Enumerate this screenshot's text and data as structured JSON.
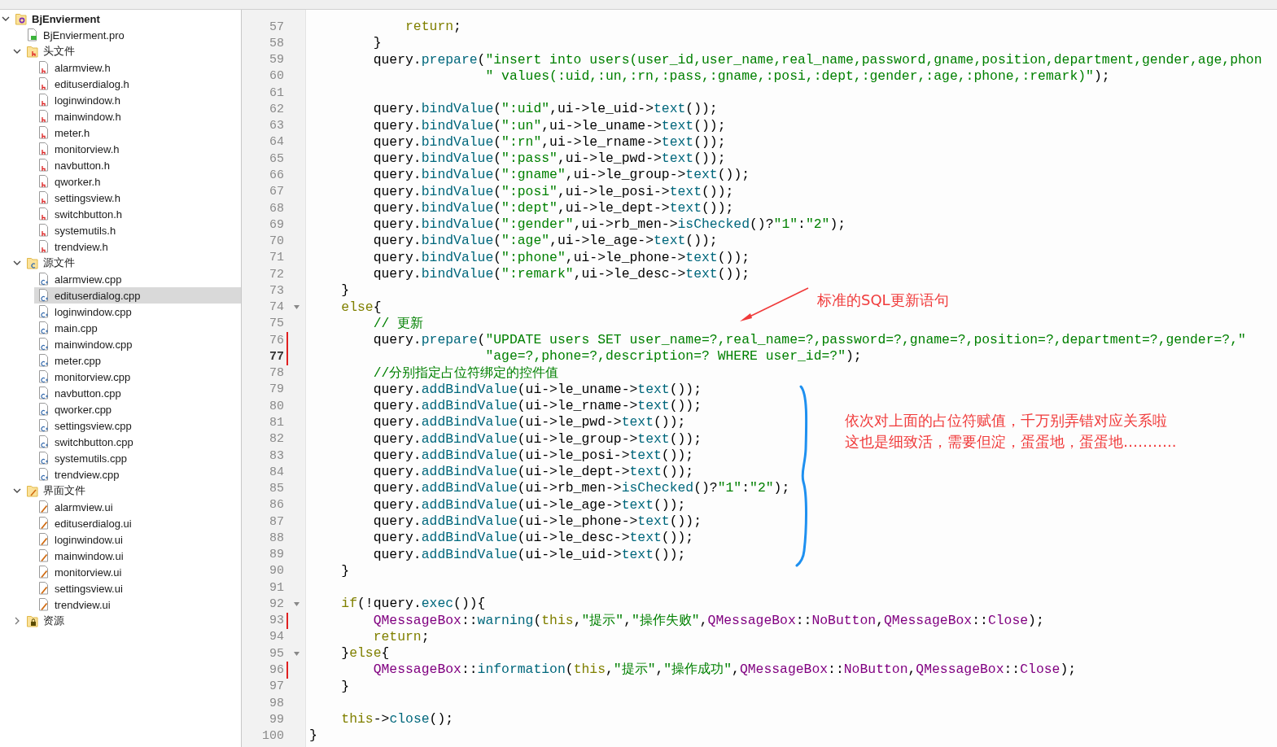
{
  "project_tree": [
    {
      "label": "BjEnvierment",
      "kind": "project",
      "expanded": true,
      "selected": false,
      "children": [
        {
          "label": "BjEnvierment.pro",
          "kind": "pro-file",
          "selected": false
        },
        {
          "label": "头文件",
          "kind": "header-folder",
          "expanded": true,
          "selected": false,
          "children": [
            {
              "label": "alarmview.h",
              "kind": "header",
              "selected": false
            },
            {
              "label": "edituserdialog.h",
              "kind": "header",
              "selected": false
            },
            {
              "label": "loginwindow.h",
              "kind": "header",
              "selected": false
            },
            {
              "label": "mainwindow.h",
              "kind": "header",
              "selected": false
            },
            {
              "label": "meter.h",
              "kind": "header",
              "selected": false
            },
            {
              "label": "monitorview.h",
              "kind": "header",
              "selected": false
            },
            {
              "label": "navbutton.h",
              "kind": "header",
              "selected": false
            },
            {
              "label": "qworker.h",
              "kind": "header",
              "selected": false
            },
            {
              "label": "settingsview.h",
              "kind": "header",
              "selected": false
            },
            {
              "label": "switchbutton.h",
              "kind": "header",
              "selected": false
            },
            {
              "label": "systemutils.h",
              "kind": "header",
              "selected": false
            },
            {
              "label": "trendview.h",
              "kind": "header",
              "selected": false
            }
          ]
        },
        {
          "label": "源文件",
          "kind": "source-folder",
          "expanded": true,
          "selected": false,
          "children": [
            {
              "label": "alarmview.cpp",
              "kind": "source",
              "selected": false
            },
            {
              "label": "edituserdialog.cpp",
              "kind": "source",
              "selected": true
            },
            {
              "label": "loginwindow.cpp",
              "kind": "source",
              "selected": false
            },
            {
              "label": "main.cpp",
              "kind": "source",
              "selected": false
            },
            {
              "label": "mainwindow.cpp",
              "kind": "source",
              "selected": false
            },
            {
              "label": "meter.cpp",
              "kind": "source",
              "selected": false
            },
            {
              "label": "monitorview.cpp",
              "kind": "source",
              "selected": false
            },
            {
              "label": "navbutton.cpp",
              "kind": "source",
              "selected": false
            },
            {
              "label": "qworker.cpp",
              "kind": "source",
              "selected": false
            },
            {
              "label": "settingsview.cpp",
              "kind": "source",
              "selected": false
            },
            {
              "label": "switchbutton.cpp",
              "kind": "source",
              "selected": false
            },
            {
              "label": "systemutils.cpp",
              "kind": "source",
              "selected": false
            },
            {
              "label": "trendview.cpp",
              "kind": "source",
              "selected": false
            }
          ]
        },
        {
          "label": "界面文件",
          "kind": "forms-folder",
          "expanded": true,
          "selected": false,
          "children": [
            {
              "label": "alarmview.ui",
              "kind": "form",
              "selected": false
            },
            {
              "label": "edituserdialog.ui",
              "kind": "form",
              "selected": false
            },
            {
              "label": "loginwindow.ui",
              "kind": "form",
              "selected": false
            },
            {
              "label": "mainwindow.ui",
              "kind": "form",
              "selected": false
            },
            {
              "label": "monitorview.ui",
              "kind": "form",
              "selected": false
            },
            {
              "label": "settingsview.ui",
              "kind": "form",
              "selected": false
            },
            {
              "label": "trendview.ui",
              "kind": "form",
              "selected": false
            }
          ]
        },
        {
          "label": "资源",
          "kind": "resource-folder",
          "expanded": false,
          "selected": false
        }
      ]
    }
  ],
  "editor": {
    "lines": [
      {
        "number": "57",
        "changed": false,
        "foldable": false,
        "current": false,
        "tokens": [
          {
            "kind": "keyword",
            "text": "            return"
          },
          {
            "kind": "plain",
            "text": ";"
          }
        ]
      },
      {
        "number": "58",
        "changed": false,
        "foldable": false,
        "current": false,
        "tokens": [
          {
            "kind": "plain",
            "text": "        }"
          }
        ]
      },
      {
        "number": "59",
        "changed": false,
        "foldable": false,
        "current": false,
        "tokens": [
          {
            "kind": "plain",
            "text": "        query."
          },
          {
            "kind": "function",
            "text": "prepare"
          },
          {
            "kind": "plain",
            "text": "("
          },
          {
            "kind": "string",
            "text": "\"insert into users(user_id,user_name,real_name,password,gname,position,department,gender,age,phon"
          }
        ]
      },
      {
        "number": "60",
        "changed": false,
        "foldable": false,
        "current": false,
        "tokens": [
          {
            "kind": "string",
            "text": "                      \" values(:uid,:un,:rn,:pass,:gname,:posi,:dept,:gender,:age,:phone,:remark)\""
          },
          {
            "kind": "plain",
            "text": ");"
          }
        ]
      },
      {
        "number": "61",
        "changed": false,
        "foldable": false,
        "current": false
      },
      {
        "number": "62",
        "changed": false,
        "foldable": false,
        "current": false,
        "tokens": [
          {
            "kind": "plain",
            "text": "        query."
          },
          {
            "kind": "function",
            "text": "bindValue"
          },
          {
            "kind": "plain",
            "text": "("
          },
          {
            "kind": "string",
            "text": "\":uid\""
          },
          {
            "kind": "plain",
            "text": ",ui->le_uid->"
          },
          {
            "kind": "function",
            "text": "text"
          },
          {
            "kind": "plain",
            "text": "());"
          }
        ]
      },
      {
        "number": "63",
        "changed": false,
        "foldable": false,
        "current": false,
        "tokens": [
          {
            "kind": "plain",
            "text": "        query."
          },
          {
            "kind": "function",
            "text": "bindValue"
          },
          {
            "kind": "plain",
            "text": "("
          },
          {
            "kind": "string",
            "text": "\":un\""
          },
          {
            "kind": "plain",
            "text": ",ui->le_uname->"
          },
          {
            "kind": "function",
            "text": "text"
          },
          {
            "kind": "plain",
            "text": "());"
          }
        ]
      },
      {
        "number": "64",
        "changed": false,
        "foldable": false,
        "current": false,
        "tokens": [
          {
            "kind": "plain",
            "text": "        query."
          },
          {
            "kind": "function",
            "text": "bindValue"
          },
          {
            "kind": "plain",
            "text": "("
          },
          {
            "kind": "string",
            "text": "\":rn\""
          },
          {
            "kind": "plain",
            "text": ",ui->le_rname->"
          },
          {
            "kind": "function",
            "text": "text"
          },
          {
            "kind": "plain",
            "text": "());"
          }
        ]
      },
      {
        "number": "65",
        "changed": false,
        "foldable": false,
        "current": false,
        "tokens": [
          {
            "kind": "plain",
            "text": "        query."
          },
          {
            "kind": "function",
            "text": "bindValue"
          },
          {
            "kind": "plain",
            "text": "("
          },
          {
            "kind": "string",
            "text": "\":pass\""
          },
          {
            "kind": "plain",
            "text": ",ui->le_pwd->"
          },
          {
            "kind": "function",
            "text": "text"
          },
          {
            "kind": "plain",
            "text": "());"
          }
        ]
      },
      {
        "number": "66",
        "changed": false,
        "foldable": false,
        "current": false,
        "tokens": [
          {
            "kind": "plain",
            "text": "        query."
          },
          {
            "kind": "function",
            "text": "bindValue"
          },
          {
            "kind": "plain",
            "text": "("
          },
          {
            "kind": "string",
            "text": "\":gname\""
          },
          {
            "kind": "plain",
            "text": ",ui->le_group->"
          },
          {
            "kind": "function",
            "text": "text"
          },
          {
            "kind": "plain",
            "text": "());"
          }
        ]
      },
      {
        "number": "67",
        "changed": false,
        "foldable": false,
        "current": false,
        "tokens": [
          {
            "kind": "plain",
            "text": "        query."
          },
          {
            "kind": "function",
            "text": "bindValue"
          },
          {
            "kind": "plain",
            "text": "("
          },
          {
            "kind": "string",
            "text": "\":posi\""
          },
          {
            "kind": "plain",
            "text": ",ui->le_posi->"
          },
          {
            "kind": "function",
            "text": "text"
          },
          {
            "kind": "plain",
            "text": "());"
          }
        ]
      },
      {
        "number": "68",
        "changed": false,
        "foldable": false,
        "current": false,
        "tokens": [
          {
            "kind": "plain",
            "text": "        query."
          },
          {
            "kind": "function",
            "text": "bindValue"
          },
          {
            "kind": "plain",
            "text": "("
          },
          {
            "kind": "string",
            "text": "\":dept\""
          },
          {
            "kind": "plain",
            "text": ",ui->le_dept->"
          },
          {
            "kind": "function",
            "text": "text"
          },
          {
            "kind": "plain",
            "text": "());"
          }
        ]
      },
      {
        "number": "69",
        "changed": false,
        "foldable": false,
        "current": false,
        "tokens": [
          {
            "kind": "plain",
            "text": "        query."
          },
          {
            "kind": "function",
            "text": "bindValue"
          },
          {
            "kind": "plain",
            "text": "("
          },
          {
            "kind": "string",
            "text": "\":gender\""
          },
          {
            "kind": "plain",
            "text": ",ui->rb_men->"
          },
          {
            "kind": "function",
            "text": "isChecked"
          },
          {
            "kind": "plain",
            "text": "()?"
          },
          {
            "kind": "string",
            "text": "\"1\""
          },
          {
            "kind": "plain",
            "text": ":"
          },
          {
            "kind": "string",
            "text": "\"2\""
          },
          {
            "kind": "plain",
            "text": ");"
          }
        ]
      },
      {
        "number": "70",
        "changed": false,
        "foldable": false,
        "current": false,
        "tokens": [
          {
            "kind": "plain",
            "text": "        query."
          },
          {
            "kind": "function",
            "text": "bindValue"
          },
          {
            "kind": "plain",
            "text": "("
          },
          {
            "kind": "string",
            "text": "\":age\""
          },
          {
            "kind": "plain",
            "text": ",ui->le_age->"
          },
          {
            "kind": "function",
            "text": "text"
          },
          {
            "kind": "plain",
            "text": "());"
          }
        ]
      },
      {
        "number": "71",
        "changed": false,
        "foldable": false,
        "current": false,
        "tokens": [
          {
            "kind": "plain",
            "text": "        query."
          },
          {
            "kind": "function",
            "text": "bindValue"
          },
          {
            "kind": "plain",
            "text": "("
          },
          {
            "kind": "string",
            "text": "\":phone\""
          },
          {
            "kind": "plain",
            "text": ",ui->le_phone->"
          },
          {
            "kind": "function",
            "text": "text"
          },
          {
            "kind": "plain",
            "text": "());"
          }
        ]
      },
      {
        "number": "72",
        "changed": false,
        "foldable": false,
        "current": false,
        "tokens": [
          {
            "kind": "plain",
            "text": "        query."
          },
          {
            "kind": "function",
            "text": "bindValue"
          },
          {
            "kind": "plain",
            "text": "("
          },
          {
            "kind": "string",
            "text": "\":remark\""
          },
          {
            "kind": "plain",
            "text": ",ui->le_desc->"
          },
          {
            "kind": "function",
            "text": "text"
          },
          {
            "kind": "plain",
            "text": "());"
          }
        ]
      },
      {
        "number": "73",
        "changed": false,
        "foldable": false,
        "current": false,
        "tokens": [
          {
            "kind": "plain",
            "text": "    }"
          }
        ]
      },
      {
        "number": "74",
        "changed": false,
        "foldable": true,
        "current": false,
        "tokens": [
          {
            "kind": "keyword",
            "text": "    else"
          },
          {
            "kind": "plain",
            "text": "{"
          }
        ]
      },
      {
        "number": "75",
        "changed": false,
        "foldable": false,
        "current": false,
        "tokens": [
          {
            "kind": "comment",
            "text": "        // 更新"
          }
        ]
      },
      {
        "number": "76",
        "changed": true,
        "foldable": false,
        "current": false,
        "tokens": [
          {
            "kind": "plain",
            "text": "        query."
          },
          {
            "kind": "function",
            "text": "prepare"
          },
          {
            "kind": "plain",
            "text": "("
          },
          {
            "kind": "string",
            "text": "\"UPDATE users SET user_name=?,real_name=?,password=?,gname=?,position=?,department=?,gender=?,\""
          }
        ]
      },
      {
        "number": "77",
        "changed": true,
        "foldable": false,
        "current": true,
        "tokens": [
          {
            "kind": "string",
            "text": "                      \"age=?,phone=?,description=? WHERE user_id=?\""
          },
          {
            "kind": "plain",
            "text": ");"
          }
        ]
      },
      {
        "number": "78",
        "changed": false,
        "foldable": false,
        "current": false,
        "tokens": [
          {
            "kind": "comment",
            "text": "        //分别指定占位符绑定的控件值"
          }
        ]
      },
      {
        "number": "79",
        "changed": false,
        "foldable": false,
        "current": false,
        "tokens": [
          {
            "kind": "plain",
            "text": "        query."
          },
          {
            "kind": "function",
            "text": "addBindValue"
          },
          {
            "kind": "plain",
            "text": "(ui->le_uname->"
          },
          {
            "kind": "function",
            "text": "text"
          },
          {
            "kind": "plain",
            "text": "());"
          }
        ]
      },
      {
        "number": "80",
        "changed": false,
        "foldable": false,
        "current": false,
        "tokens": [
          {
            "kind": "plain",
            "text": "        query."
          },
          {
            "kind": "function",
            "text": "addBindValue"
          },
          {
            "kind": "plain",
            "text": "(ui->le_rname->"
          },
          {
            "kind": "function",
            "text": "text"
          },
          {
            "kind": "plain",
            "text": "());"
          }
        ]
      },
      {
        "number": "81",
        "changed": false,
        "foldable": false,
        "current": false,
        "tokens": [
          {
            "kind": "plain",
            "text": "        query."
          },
          {
            "kind": "function",
            "text": "addBindValue"
          },
          {
            "kind": "plain",
            "text": "(ui->le_pwd->"
          },
          {
            "kind": "function",
            "text": "text"
          },
          {
            "kind": "plain",
            "text": "());"
          }
        ]
      },
      {
        "number": "82",
        "changed": false,
        "foldable": false,
        "current": false,
        "tokens": [
          {
            "kind": "plain",
            "text": "        query."
          },
          {
            "kind": "function",
            "text": "addBindValue"
          },
          {
            "kind": "plain",
            "text": "(ui->le_group->"
          },
          {
            "kind": "function",
            "text": "text"
          },
          {
            "kind": "plain",
            "text": "());"
          }
        ]
      },
      {
        "number": "83",
        "changed": false,
        "foldable": false,
        "current": false,
        "tokens": [
          {
            "kind": "plain",
            "text": "        query."
          },
          {
            "kind": "function",
            "text": "addBindValue"
          },
          {
            "kind": "plain",
            "text": "(ui->le_posi->"
          },
          {
            "kind": "function",
            "text": "text"
          },
          {
            "kind": "plain",
            "text": "());"
          }
        ]
      },
      {
        "number": "84",
        "changed": false,
        "foldable": false,
        "current": false,
        "tokens": [
          {
            "kind": "plain",
            "text": "        query."
          },
          {
            "kind": "function",
            "text": "addBindValue"
          },
          {
            "kind": "plain",
            "text": "(ui->le_dept->"
          },
          {
            "kind": "function",
            "text": "text"
          },
          {
            "kind": "plain",
            "text": "());"
          }
        ]
      },
      {
        "number": "85",
        "changed": false,
        "foldable": false,
        "current": false,
        "tokens": [
          {
            "kind": "plain",
            "text": "        query."
          },
          {
            "kind": "function",
            "text": "addBindValue"
          },
          {
            "kind": "plain",
            "text": "(ui->rb_men->"
          },
          {
            "kind": "function",
            "text": "isChecked"
          },
          {
            "kind": "plain",
            "text": "()?"
          },
          {
            "kind": "string",
            "text": "\"1\""
          },
          {
            "kind": "plain",
            "text": ":"
          },
          {
            "kind": "string",
            "text": "\"2\""
          },
          {
            "kind": "plain",
            "text": ");"
          }
        ]
      },
      {
        "number": "86",
        "changed": false,
        "foldable": false,
        "current": false,
        "tokens": [
          {
            "kind": "plain",
            "text": "        query."
          },
          {
            "kind": "function",
            "text": "addBindValue"
          },
          {
            "kind": "plain",
            "text": "(ui->le_age->"
          },
          {
            "kind": "function",
            "text": "text"
          },
          {
            "kind": "plain",
            "text": "());"
          }
        ]
      },
      {
        "number": "87",
        "changed": false,
        "foldable": false,
        "current": false,
        "tokens": [
          {
            "kind": "plain",
            "text": "        query."
          },
          {
            "kind": "function",
            "text": "addBindValue"
          },
          {
            "kind": "plain",
            "text": "(ui->le_phone->"
          },
          {
            "kind": "function",
            "text": "text"
          },
          {
            "kind": "plain",
            "text": "());"
          }
        ]
      },
      {
        "number": "88",
        "changed": false,
        "foldable": false,
        "current": false,
        "tokens": [
          {
            "kind": "plain",
            "text": "        query."
          },
          {
            "kind": "function",
            "text": "addBindValue"
          },
          {
            "kind": "plain",
            "text": "(ui->le_desc->"
          },
          {
            "kind": "function",
            "text": "text"
          },
          {
            "kind": "plain",
            "text": "());"
          }
        ]
      },
      {
        "number": "89",
        "changed": false,
        "foldable": false,
        "current": false,
        "tokens": [
          {
            "kind": "plain",
            "text": "        query."
          },
          {
            "kind": "function",
            "text": "addBindValue"
          },
          {
            "kind": "plain",
            "text": "(ui->le_uid->"
          },
          {
            "kind": "function",
            "text": "text"
          },
          {
            "kind": "plain",
            "text": "());"
          }
        ]
      },
      {
        "number": "90",
        "changed": false,
        "foldable": false,
        "current": false,
        "tokens": [
          {
            "kind": "plain",
            "text": "    }"
          }
        ]
      },
      {
        "number": "91",
        "changed": false,
        "foldable": false,
        "current": false
      },
      {
        "number": "92",
        "changed": false,
        "foldable": true,
        "current": false,
        "tokens": [
          {
            "kind": "keyword",
            "text": "    if"
          },
          {
            "kind": "plain",
            "text": "(!query."
          },
          {
            "kind": "function",
            "text": "exec"
          },
          {
            "kind": "plain",
            "text": "()){"
          }
        ]
      },
      {
        "number": "93",
        "changed": true,
        "foldable": false,
        "current": false,
        "tokens": [
          {
            "kind": "type",
            "text": "        QMessageBox"
          },
          {
            "kind": "plain",
            "text": "::"
          },
          {
            "kind": "function",
            "text": "warning"
          },
          {
            "kind": "plain",
            "text": "("
          },
          {
            "kind": "keyword",
            "text": "this"
          },
          {
            "kind": "plain",
            "text": ","
          },
          {
            "kind": "string",
            "text": "\"提示\""
          },
          {
            "kind": "plain",
            "text": ","
          },
          {
            "kind": "string",
            "text": "\"操作失败\""
          },
          {
            "kind": "plain",
            "text": ","
          },
          {
            "kind": "type",
            "text": "QMessageBox"
          },
          {
            "kind": "plain",
            "text": "::"
          },
          {
            "kind": "type",
            "text": "NoButton"
          },
          {
            "kind": "plain",
            "text": ","
          },
          {
            "kind": "type",
            "text": "QMessageBox"
          },
          {
            "kind": "plain",
            "text": "::"
          },
          {
            "kind": "type",
            "text": "Close"
          },
          {
            "kind": "plain",
            "text": ");"
          }
        ]
      },
      {
        "number": "94",
        "changed": false,
        "foldable": false,
        "current": false,
        "tokens": [
          {
            "kind": "keyword",
            "text": "        return"
          },
          {
            "kind": "plain",
            "text": ";"
          }
        ]
      },
      {
        "number": "95",
        "changed": false,
        "foldable": true,
        "current": false,
        "tokens": [
          {
            "kind": "plain",
            "text": "    }"
          },
          {
            "kind": "keyword",
            "text": "else"
          },
          {
            "kind": "plain",
            "text": "{"
          }
        ]
      },
      {
        "number": "96",
        "changed": true,
        "foldable": false,
        "current": false,
        "tokens": [
          {
            "kind": "type",
            "text": "        QMessageBox"
          },
          {
            "kind": "plain",
            "text": "::"
          },
          {
            "kind": "function",
            "text": "information"
          },
          {
            "kind": "plain",
            "text": "("
          },
          {
            "kind": "keyword",
            "text": "this"
          },
          {
            "kind": "plain",
            "text": ","
          },
          {
            "kind": "string",
            "text": "\"提示\""
          },
          {
            "kind": "plain",
            "text": ","
          },
          {
            "kind": "string",
            "text": "\"操作成功\""
          },
          {
            "kind": "plain",
            "text": ","
          },
          {
            "kind": "type",
            "text": "QMessageBox"
          },
          {
            "kind": "plain",
            "text": "::"
          },
          {
            "kind": "type",
            "text": "NoButton"
          },
          {
            "kind": "plain",
            "text": ","
          },
          {
            "kind": "type",
            "text": "QMessageBox"
          },
          {
            "kind": "plain",
            "text": "::"
          },
          {
            "kind": "type",
            "text": "Close"
          },
          {
            "kind": "plain",
            "text": ");"
          }
        ]
      },
      {
        "number": "97",
        "changed": false,
        "foldable": false,
        "current": false,
        "tokens": [
          {
            "kind": "plain",
            "text": "    }"
          }
        ]
      },
      {
        "number": "98",
        "changed": false,
        "foldable": false,
        "current": false
      },
      {
        "number": "99",
        "changed": false,
        "foldable": false,
        "current": false,
        "tokens": [
          {
            "kind": "keyword",
            "text": "    this"
          },
          {
            "kind": "plain",
            "text": "->"
          },
          {
            "kind": "function",
            "text": "close"
          },
          {
            "kind": "plain",
            "text": "();"
          }
        ]
      },
      {
        "number": "100",
        "changed": false,
        "foldable": false,
        "current": false,
        "tokens": [
          {
            "kind": "plain",
            "text": "}"
          }
        ]
      }
    ]
  },
  "annotations": {
    "sql_note": "标准的SQL更新语句",
    "binding_note_lines": [
      "依次对上面的占位符赋值，千万别弄错对应关系啦",
      "这也是细致活，需要但淀，蛋蛋地，蛋蛋地……….."
    ]
  }
}
